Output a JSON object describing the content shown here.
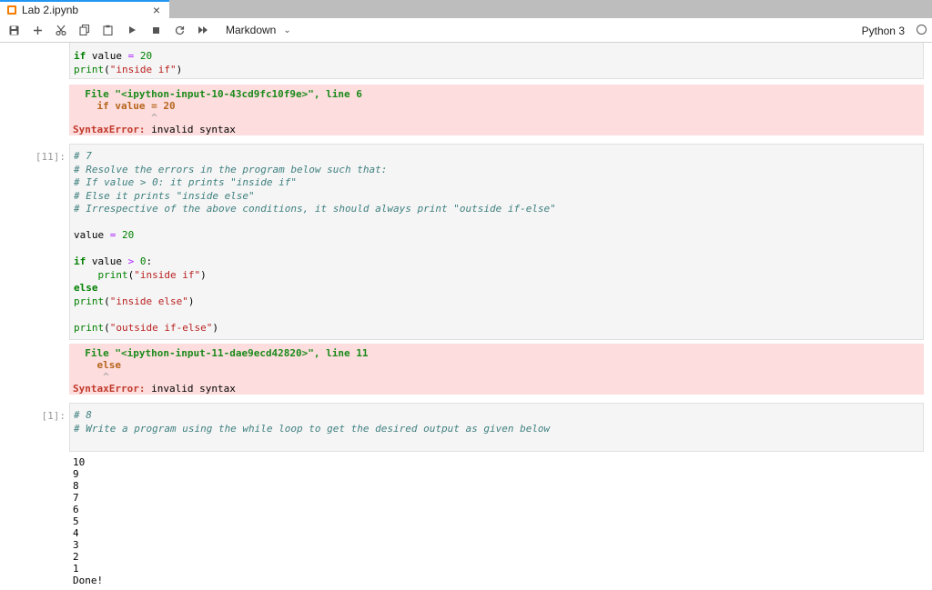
{
  "tab": {
    "title": "Lab 2.ipynb",
    "close": "×"
  },
  "toolbar": {
    "icons": [
      "save-icon",
      "add-icon",
      "cut-icon",
      "copy-icon",
      "paste-icon",
      "run-icon",
      "stop-icon",
      "restart-icon",
      "fast-forward-icon"
    ],
    "cell_type": "Markdown",
    "kernel": "Python 3"
  },
  "cells": {
    "c0": {
      "input": [
        "if value = 20",
        "print(\"inside if\")"
      ],
      "error": {
        "file_prefix": "File ",
        "file_name": "\"<ipython-input-10-43cd9fc10f9e>\"",
        "line_label": ", line 6",
        "code": "if value = 20",
        "caret": "^",
        "name": "SyntaxError:",
        "message": " invalid syntax"
      }
    },
    "c1": {
      "prompt": "[11]:",
      "comments": [
        "# 7",
        "# Resolve the errors in the program below such that:",
        "# If value > 0: it prints \"inside if\"",
        "# Else it prints \"inside else\"",
        "# Irrespective of the above conditions, it should always print \"outside if-else\""
      ],
      "code": {
        "assign_var": "value ",
        "assign_op": "=",
        "assign_num": " 20",
        "if_kw": "if",
        "if_rest": " value ",
        "if_op": ">",
        "if_num": " 0",
        "if_colon": ":",
        "indent": "    ",
        "print1_fn": "print",
        "print1_str": "\"inside if\"",
        "else_kw": "else",
        "print2_fn": "print",
        "print2_str": "\"inside else\"",
        "print3_fn": "print",
        "print3_str": "\"outside if-else\""
      },
      "error": {
        "file_prefix": "File ",
        "file_name": "\"<ipython-input-11-dae9ecd42820>\"",
        "line_label": ", line 11",
        "code": "else",
        "caret": "^",
        "name": "SyntaxError:",
        "message": " invalid syntax"
      }
    },
    "c2": {
      "prompt": "[1]:",
      "comments": [
        "# 8",
        "# Write a program using the while loop to get the desired output as given below"
      ],
      "output": [
        "10",
        "9",
        "8",
        "7",
        "6",
        "5",
        "4",
        "3",
        "2",
        "1",
        "Done!"
      ]
    }
  }
}
